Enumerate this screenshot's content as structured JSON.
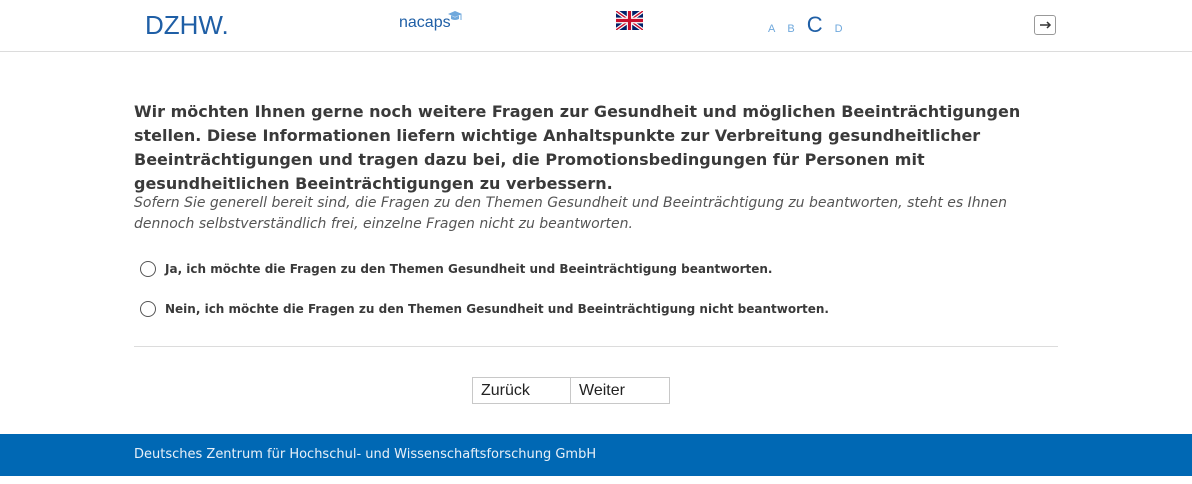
{
  "header": {
    "logo_text": "DZHW.",
    "partner_logo_text": "nacaps",
    "language_flag": "uk-flag-icon",
    "font_sizes": [
      "A",
      "B",
      "C",
      "D"
    ],
    "active_font_size": "C",
    "logout_icon": "logout-arrow-icon"
  },
  "main": {
    "question": "Wir möchten Ihnen gerne noch weitere Fragen zur Gesundheit und möglichen Beeinträchtigungen stellen. Diese Informationen liefern wichtige Anhaltspunkte zur Verbreitung gesundheitlicher Beeinträchtigungen und tragen dazu bei, die Promotionsbedingungen für Personen mit gesundheitlichen Beeinträchtigungen zu verbessern.",
    "hint": "Sofern Sie generell bereit sind, die Fragen zu den Themen Gesundheit und Beeinträchtigung zu beantworten, steht es Ihnen dennoch selbstverständlich frei, einzelne Fragen nicht zu beantworten.",
    "options": [
      {
        "label": "Ja, ich möchte die Fragen zu den Themen Gesundheit und Beeinträchtigung beantworten."
      },
      {
        "label": "Nein, ich möchte die Fragen zu den Themen Gesundheit und Beeinträchtigung nicht beantworten."
      }
    ]
  },
  "navigation": {
    "back_label": "Zurück",
    "next_label": "Weiter"
  },
  "footer": {
    "text": "Deutsches Zentrum für Hochschul- und Wissenschaftsforschung GmbH"
  },
  "colors": {
    "brand_blue": "#1f5fa6",
    "footer_blue": "#0068b4"
  }
}
